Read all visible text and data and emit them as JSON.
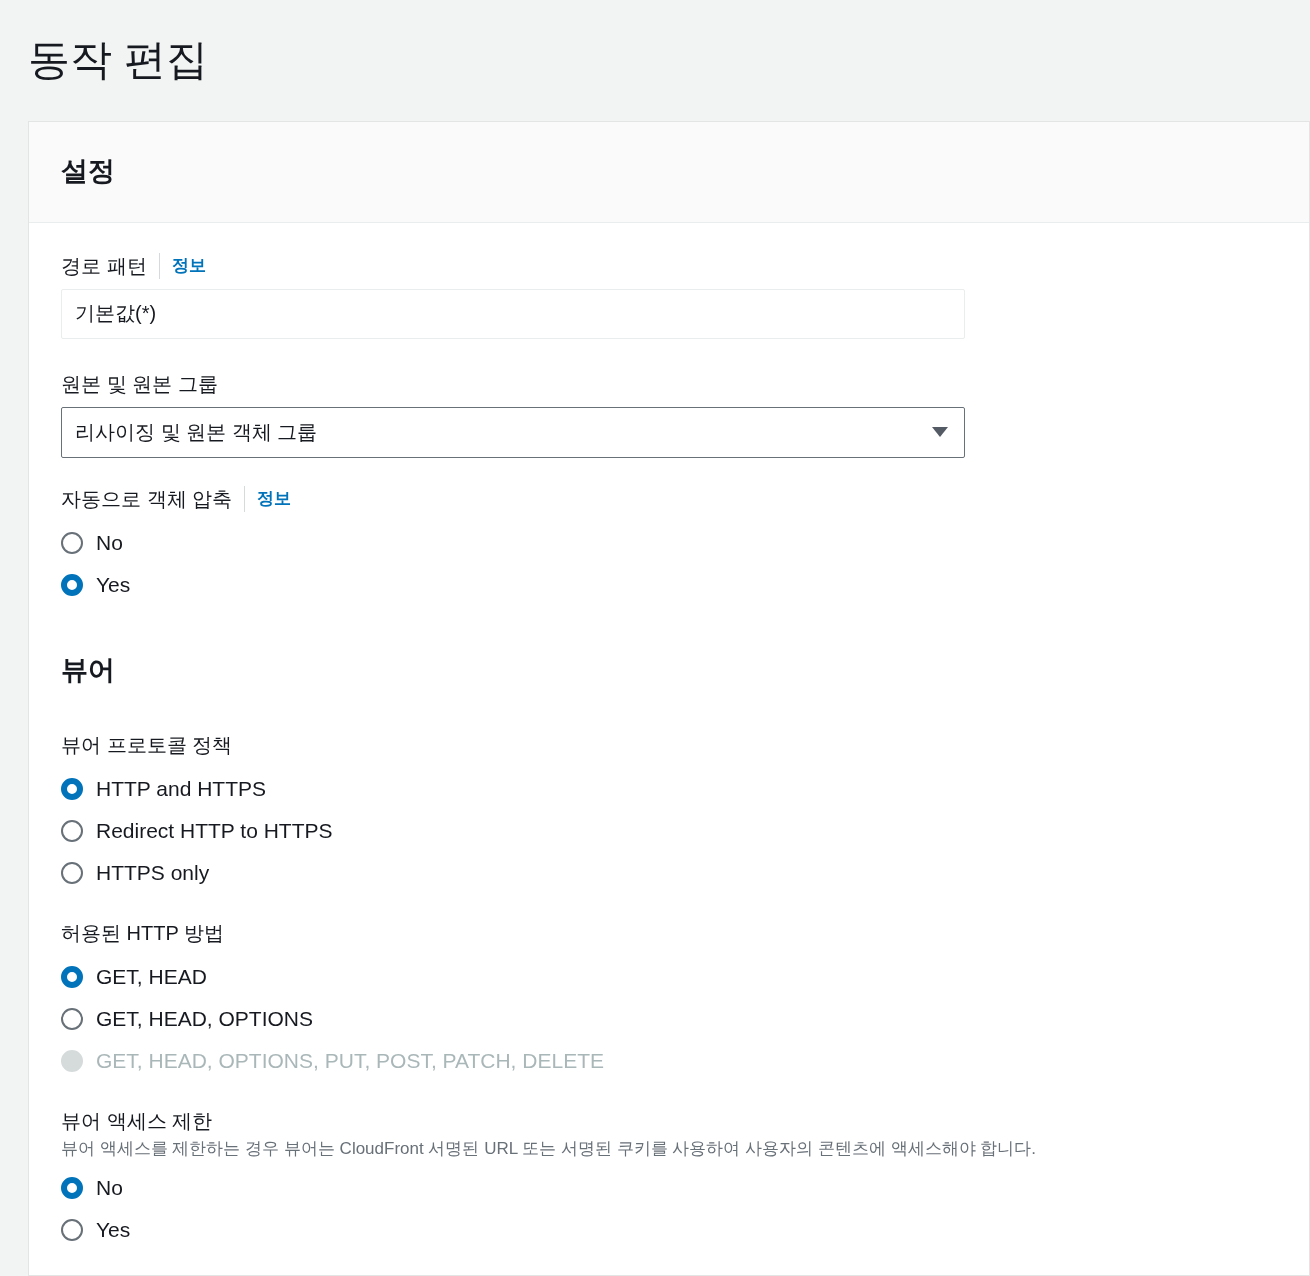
{
  "page": {
    "title": "동작 편집"
  },
  "panel": {
    "title": "설정",
    "fields": [
      {
        "kind": "text",
        "label": "경로 패턴",
        "info": "정보",
        "value": "기본값(*)"
      },
      {
        "kind": "select",
        "label": "원본 및 원본 그룹",
        "value": "리사이징 및 원본 객체 그룹"
      },
      {
        "kind": "radio",
        "label": "자동으로 객체 압축",
        "info": "정보",
        "options": [
          {
            "label": "No",
            "selected": false,
            "disabled": false
          },
          {
            "label": "Yes",
            "selected": true,
            "disabled": false
          }
        ]
      },
      {
        "kind": "heading",
        "label": "뷰어"
      },
      {
        "kind": "radio",
        "label": "뷰어 프로토콜 정책",
        "options": [
          {
            "label": "HTTP and HTTPS",
            "selected": true,
            "disabled": false
          },
          {
            "label": "Redirect HTTP to HTTPS",
            "selected": false,
            "disabled": false
          },
          {
            "label": "HTTPS only",
            "selected": false,
            "disabled": false
          }
        ]
      },
      {
        "kind": "radio",
        "label": "허용된 HTTP 방법",
        "options": [
          {
            "label": "GET, HEAD",
            "selected": true,
            "disabled": false
          },
          {
            "label": "GET, HEAD, OPTIONS",
            "selected": false,
            "disabled": false
          },
          {
            "label": "GET, HEAD, OPTIONS, PUT, POST, PATCH, DELETE",
            "selected": false,
            "disabled": true
          }
        ]
      },
      {
        "kind": "radio",
        "label": "뷰어 액세스 제한",
        "description": "뷰어 액세스를 제한하는 경우 뷰어는 CloudFront 서명된 URL 또는 서명된 쿠키를 사용하여 사용자의 콘텐츠에 액세스해야 합니다.",
        "options": [
          {
            "label": "No",
            "selected": true,
            "disabled": false
          },
          {
            "label": "Yes",
            "selected": false,
            "disabled": false
          }
        ]
      }
    ]
  }
}
